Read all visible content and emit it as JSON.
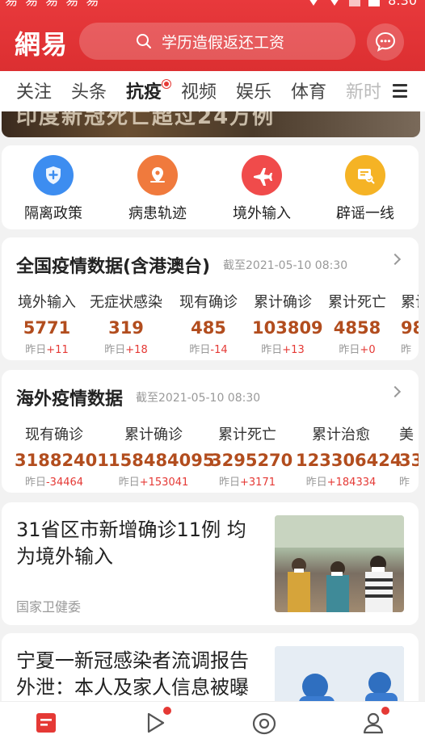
{
  "app": {
    "logo": "網易",
    "search_placeholder": "学历造假返还工资"
  },
  "statusbar": {
    "left": "易 易 易 易 易",
    "time": "8:30"
  },
  "tabs": [
    {
      "label": "关注"
    },
    {
      "label": "头条"
    },
    {
      "label": "抗疫"
    },
    {
      "label": "视频"
    },
    {
      "label": "娱乐"
    },
    {
      "label": "体育"
    },
    {
      "label": "新时"
    }
  ],
  "banner": {
    "text": "印度新冠死亡超过24万例"
  },
  "quick_links": [
    {
      "label": "隔离政策",
      "icon": "shield-plus-icon",
      "color": "#3d8df0"
    },
    {
      "label": "病患轨迹",
      "icon": "location-pin-icon",
      "color": "#f07a3d"
    },
    {
      "label": "境外输入",
      "icon": "airplane-icon",
      "color": "#f04b4b"
    },
    {
      "label": "辟谣一线",
      "icon": "search-doc-icon",
      "color": "#f5b325"
    }
  ],
  "domestic": {
    "title": "全国疫情数据(含港澳台)",
    "date": "截至2021-05-10 08:30",
    "stats": [
      {
        "label": "境外输入",
        "value": "5771",
        "delta_prefix": "昨日",
        "delta": "+11"
      },
      {
        "label": "无症状感染",
        "value": "319",
        "delta_prefix": "昨日",
        "delta": "+18"
      },
      {
        "label": "现有确诊",
        "value": "485",
        "delta_prefix": "昨日",
        "delta": "-14"
      },
      {
        "label": "累计确诊",
        "value": "103809",
        "delta_prefix": "昨日",
        "delta": "+13"
      },
      {
        "label": "累计死亡",
        "value": "4858",
        "delta_prefix": "昨日",
        "delta": "+0"
      },
      {
        "label": "累计",
        "value": "98",
        "delta_prefix": "昨",
        "delta": ""
      }
    ]
  },
  "overseas": {
    "title": "海外疫情数据",
    "date": "截至2021-05-10 08:30",
    "stats": [
      {
        "label": "现有确诊",
        "value": "31882401",
        "delta_prefix": "昨日",
        "delta": "-34464"
      },
      {
        "label": "累计确诊",
        "value": "158484095",
        "delta_prefix": "昨日",
        "delta": "+153041"
      },
      {
        "label": "累计死亡",
        "value": "3295270",
        "delta_prefix": "昨日",
        "delta": "+3171"
      },
      {
        "label": "累计治愈",
        "value": "123306424",
        "delta_prefix": "昨日",
        "delta": "+184334"
      },
      {
        "label": "美",
        "value": "33",
        "delta_prefix": "昨",
        "delta": ""
      }
    ]
  },
  "news": [
    {
      "title": "31省区市新增确诊11例 均为境外输入",
      "source": "国家卫健委"
    },
    {
      "title": "宁夏一新冠感染者流调报告外泄：本人及家人信息被曝",
      "source": ""
    }
  ]
}
